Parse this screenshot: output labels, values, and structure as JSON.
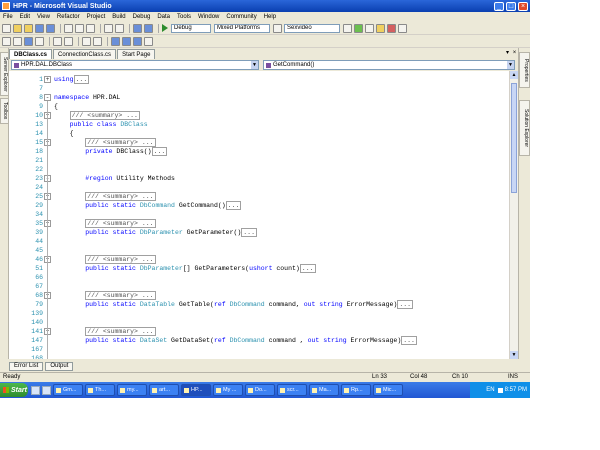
{
  "window": {
    "title": "HPR - Microsoft Visual Studio"
  },
  "menu": [
    "File",
    "Edit",
    "View",
    "Refactor",
    "Project",
    "Build",
    "Debug",
    "Data",
    "Tools",
    "Window",
    "Community",
    "Help"
  ],
  "toolbar": {
    "config": "Debug",
    "platform": "Mixed Platforms",
    "find_combo": "Sexvideo"
  },
  "side_tabs": {
    "left": [
      "Server Explorer",
      "Toolbox"
    ],
    "right": [
      "Properties",
      "Solution Explorer"
    ]
  },
  "doc_tabs": [
    "DBClass.cs",
    "ConnectionClass.cs",
    "Start Page"
  ],
  "nav": {
    "left": "HPR.DAL.DBClass",
    "right": "GetCommand()"
  },
  "code_lines": [
    {
      "n": "1",
      "fold": "+",
      "parts": [
        [
          "kw",
          "using"
        ],
        [
          "box",
          "..."
        ]
      ]
    },
    {
      "n": "7",
      "fold": "",
      "parts": []
    },
    {
      "n": "8",
      "fold": "-",
      "parts": [
        [
          "kw",
          "namespace"
        ],
        [
          "",
          " HPR.DAL"
        ]
      ]
    },
    {
      "n": "9",
      "fold": "",
      "parts": [
        [
          "",
          "{"
        ]
      ]
    },
    {
      "n": "10",
      "fold": "+",
      "parts": [
        [
          "",
          "    "
        ],
        [
          "box",
          "/// <summary> ..."
        ]
      ]
    },
    {
      "n": "13",
      "fold": "",
      "parts": [
        [
          "",
          "    "
        ],
        [
          "kw",
          "public class"
        ],
        [
          "",
          " "
        ],
        [
          "ty",
          "DBClass"
        ]
      ]
    },
    {
      "n": "14",
      "fold": "",
      "parts": [
        [
          "",
          "    {"
        ]
      ]
    },
    {
      "n": "15",
      "fold": "+",
      "parts": [
        [
          "",
          "        "
        ],
        [
          "box",
          "/// <summary> ..."
        ]
      ]
    },
    {
      "n": "18",
      "fold": "",
      "parts": [
        [
          "",
          "        "
        ],
        [
          "kw",
          "private"
        ],
        [
          "",
          " DBClass()"
        ],
        [
          "box",
          "..."
        ]
      ]
    },
    {
      "n": "21",
      "fold": "",
      "parts": []
    },
    {
      "n": "22",
      "fold": "",
      "parts": []
    },
    {
      "n": "23",
      "fold": "-",
      "parts": [
        [
          "",
          "        "
        ],
        [
          "kw",
          "#region"
        ],
        [
          "",
          " Utility Methods"
        ]
      ]
    },
    {
      "n": "24",
      "fold": "",
      "parts": []
    },
    {
      "n": "25",
      "fold": "+",
      "parts": [
        [
          "",
          "        "
        ],
        [
          "box",
          "/// <summary> ..."
        ]
      ]
    },
    {
      "n": "29",
      "fold": "",
      "parts": [
        [
          "",
          "        "
        ],
        [
          "kw",
          "public static"
        ],
        [
          "",
          " "
        ],
        [
          "ty",
          "DbCommand"
        ],
        [
          "",
          " GetCommand()"
        ],
        [
          "box",
          "..."
        ]
      ]
    },
    {
      "n": "34",
      "fold": "",
      "parts": []
    },
    {
      "n": "35",
      "fold": "+",
      "parts": [
        [
          "",
          "        "
        ],
        [
          "box",
          "/// <summary> ..."
        ]
      ]
    },
    {
      "n": "39",
      "fold": "",
      "parts": [
        [
          "",
          "        "
        ],
        [
          "kw",
          "public static"
        ],
        [
          "",
          " "
        ],
        [
          "ty",
          "DbParameter"
        ],
        [
          "",
          " GetParameter()"
        ],
        [
          "box",
          "..."
        ]
      ]
    },
    {
      "n": "44",
      "fold": "",
      "parts": []
    },
    {
      "n": "45",
      "fold": "",
      "parts": []
    },
    {
      "n": "46",
      "fold": "+",
      "parts": [
        [
          "",
          "        "
        ],
        [
          "box",
          "/// <summary> ..."
        ]
      ]
    },
    {
      "n": "51",
      "fold": "",
      "parts": [
        [
          "",
          "        "
        ],
        [
          "kw",
          "public static"
        ],
        [
          "",
          " "
        ],
        [
          "ty",
          "DbParameter"
        ],
        [
          "",
          "[] GetParameters("
        ],
        [
          "kw",
          "ushort"
        ],
        [
          "",
          " count)"
        ],
        [
          "box",
          "..."
        ]
      ]
    },
    {
      "n": "66",
      "fold": "",
      "parts": []
    },
    {
      "n": "67",
      "fold": "",
      "parts": []
    },
    {
      "n": "68",
      "fold": "+",
      "parts": [
        [
          "",
          "        "
        ],
        [
          "box",
          "/// <summary> ..."
        ]
      ]
    },
    {
      "n": "79",
      "fold": "",
      "parts": [
        [
          "",
          "        "
        ],
        [
          "kw",
          "public static"
        ],
        [
          "",
          " "
        ],
        [
          "ty",
          "DataTable"
        ],
        [
          "",
          " GetTable("
        ],
        [
          "kw",
          "ref"
        ],
        [
          "",
          " "
        ],
        [
          "ty",
          "DbCommand"
        ],
        [
          "",
          " command, "
        ],
        [
          "kw",
          "out string"
        ],
        [
          "",
          " ErrorMessage)"
        ],
        [
          "box",
          "..."
        ]
      ]
    },
    {
      "n": "139",
      "fold": "",
      "parts": []
    },
    {
      "n": "140",
      "fold": "",
      "parts": []
    },
    {
      "n": "141",
      "fold": "+",
      "parts": [
        [
          "",
          "        "
        ],
        [
          "box",
          "/// <summary> ..."
        ]
      ]
    },
    {
      "n": "147",
      "fold": "",
      "parts": [
        [
          "",
          "        "
        ],
        [
          "kw",
          "public static"
        ],
        [
          "",
          " "
        ],
        [
          "ty",
          "DataSet"
        ],
        [
          "",
          " GetDataSet("
        ],
        [
          "kw",
          "ref"
        ],
        [
          "",
          " "
        ],
        [
          "ty",
          "DbCommand"
        ],
        [
          "",
          " command , "
        ],
        [
          "kw",
          "out string"
        ],
        [
          "",
          " ErrorMessage)"
        ],
        [
          "box",
          "..."
        ]
      ]
    },
    {
      "n": "167",
      "fold": "",
      "parts": []
    },
    {
      "n": "168",
      "fold": "",
      "parts": []
    }
  ],
  "bottom_tabs": [
    "Error List",
    "Output"
  ],
  "status": {
    "ready": "Ready",
    "line": "Ln 33",
    "col": "Col 48",
    "ch": "Ch 10",
    "mode": "INS"
  },
  "taskbar": {
    "start": "Start",
    "tasks": [
      "Gm...",
      "Th...",
      "my...",
      "art...",
      "HP...",
      "My ...",
      "Do...",
      "scr...",
      "Ma...",
      "Rp...",
      "Mic..."
    ],
    "lang": "EN",
    "clock": "8:57 PM"
  },
  "colors": {
    "keyword": "#0000ff",
    "type": "#2b91af",
    "comment": "#808080",
    "line_number": "#2b91af",
    "titlebar": "#0a3fb0"
  }
}
